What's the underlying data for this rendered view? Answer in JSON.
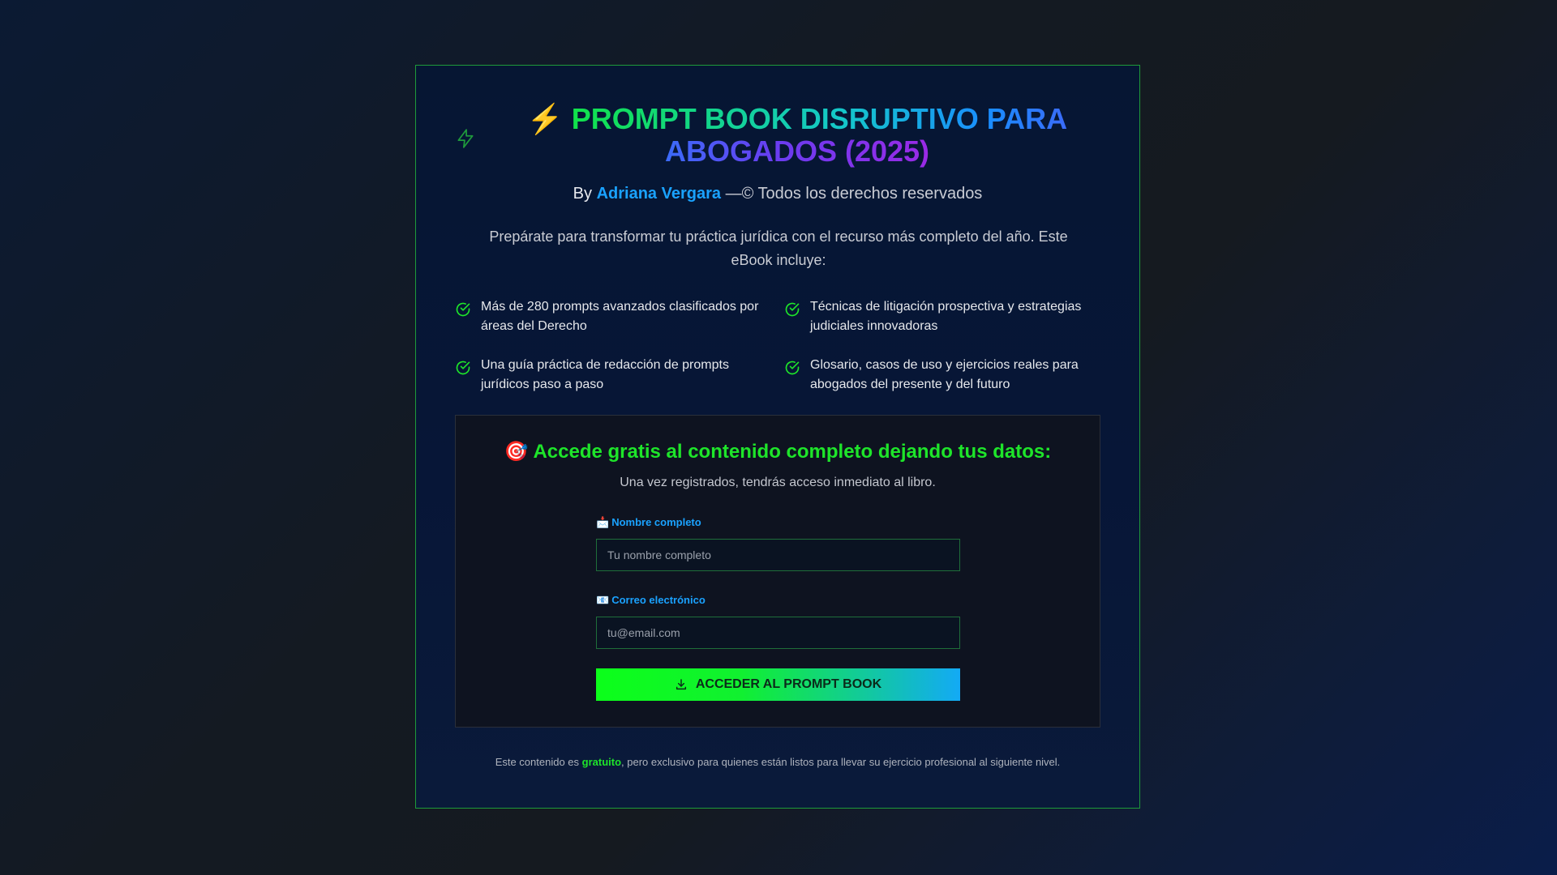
{
  "header": {
    "bolt_glyph": "⚡",
    "title": "PROMPT BOOK DISRUPTIVO PARA ABOGADOS (2025)",
    "by_prefix": "By",
    "author": "Adriana Vergara",
    "rights": "—© Todos los derechos reservados"
  },
  "intro": "Prepárate para transformar tu práctica jurídica con el recurso más completo del año. Este eBook incluye:",
  "features": [
    "Más de 280 prompts avanzados clasificados por áreas del Derecho",
    "Técnicas de litigación prospectiva y estrategias judiciales innovadoras",
    "Una guía práctica de redacción de prompts jurídicos paso a paso",
    "Glosario, casos de uso y ejercicios reales para abogados del presente y del futuro"
  ],
  "form": {
    "title": "🎯 Accede gratis al contenido completo dejando tus datos:",
    "subtitle": "Una vez registrados, tendrás acceso inmediato al libro.",
    "name_emoji": "📩",
    "name_label": "Nombre completo",
    "name_placeholder": "Tu nombre completo",
    "email_emoji": "📧",
    "email_label": "Correo electrónico",
    "email_placeholder": "tu@email.com",
    "submit_label": "ACCEDER AL PROMPT BOOK"
  },
  "footer": {
    "before": "Este contenido es ",
    "highlight": "gratuito",
    "after": ", pero exclusivo para quienes están listos para llevar su ejercicio profesional al siguiente nivel."
  },
  "colors": {
    "accent_green": "#1ee52a",
    "accent_blue": "#1aa2ff",
    "border_green": "#1e9a3a"
  },
  "icons": {
    "left_decoration": "bolt-outline-icon",
    "feature_bullet": "check-circle-icon",
    "submit": "download-icon"
  }
}
